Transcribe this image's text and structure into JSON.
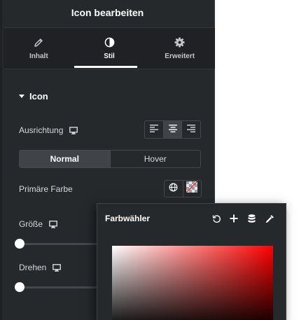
{
  "header": {
    "title": "Icon bearbeiten"
  },
  "tabs": [
    {
      "label": "Inhalt",
      "icon": "pencil-icon",
      "active": false
    },
    {
      "label": "Stil",
      "icon": "half-circle-icon",
      "active": true
    },
    {
      "label": "Erweitert",
      "icon": "gear-icon",
      "active": false
    }
  ],
  "section": {
    "title": "Icon"
  },
  "alignment": {
    "label": "Ausrichtung",
    "options": [
      "left",
      "center",
      "right"
    ],
    "selected": "center"
  },
  "state_toggle": {
    "options": [
      "Normal",
      "Hover"
    ],
    "selected": "Normal"
  },
  "primary_color": {
    "label": "Primäre Farbe"
  },
  "size": {
    "label": "Größe",
    "value": 0
  },
  "rotate": {
    "label": "Drehen",
    "value": 0
  },
  "color_picker": {
    "title": "Farbwähler",
    "actions": [
      "reset-icon",
      "plus-icon",
      "database-icon",
      "eyedropper-icon"
    ],
    "hue": "#ff0000"
  },
  "colors": {
    "panel_bg": "#26292c",
    "tabs_bg": "#1f2124",
    "border": "#45484c",
    "active_btn": "#404347",
    "text": "#d5d8dc"
  }
}
